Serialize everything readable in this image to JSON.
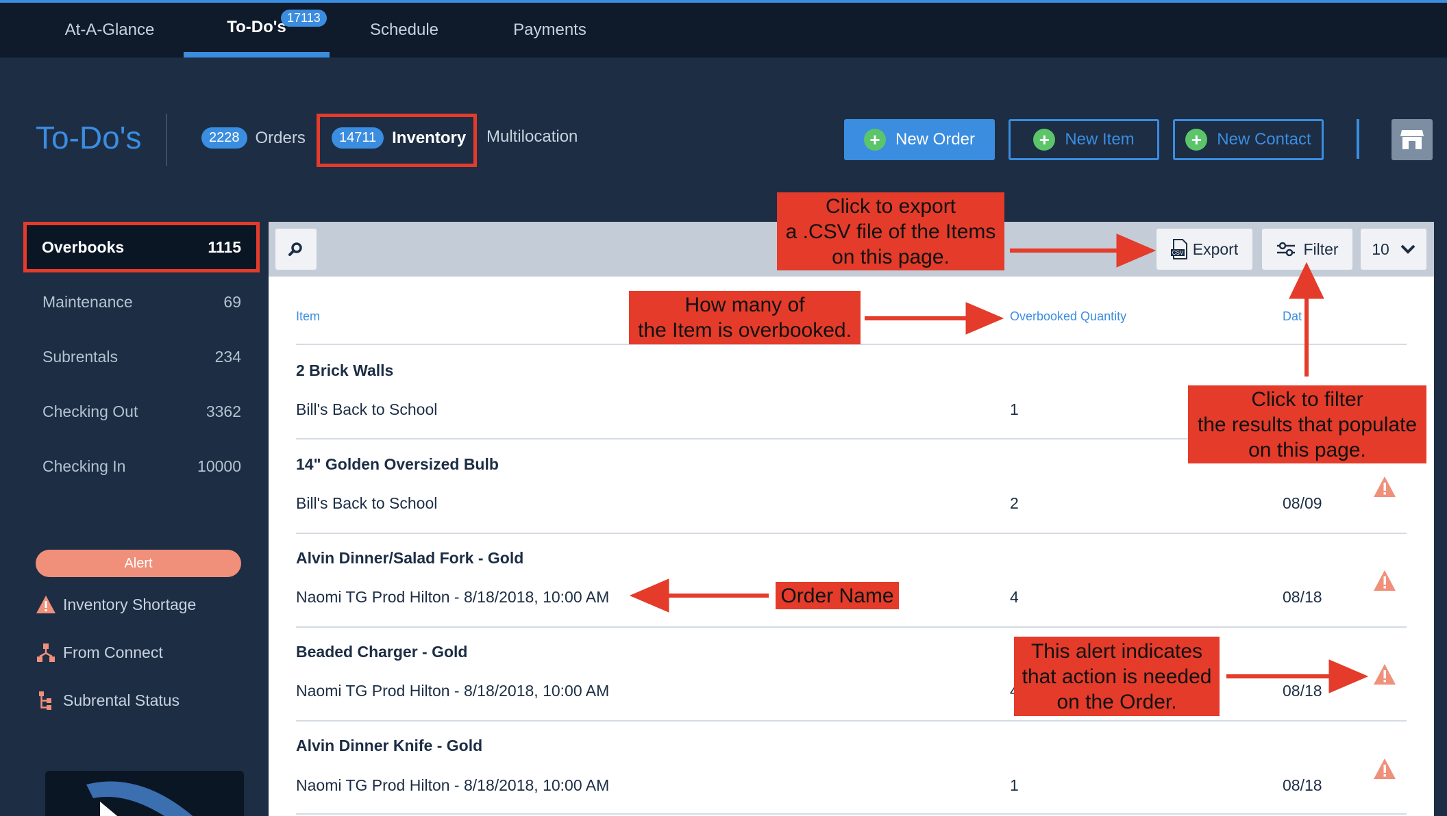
{
  "topnav": {
    "tabs": [
      {
        "label": "At-A-Glance"
      },
      {
        "label": "To-Do's",
        "badge": "17113"
      },
      {
        "label": "Schedule"
      },
      {
        "label": "Payments"
      }
    ]
  },
  "header": {
    "title": "To-Do's",
    "subtabs": [
      {
        "count": "2228",
        "label": "Orders"
      },
      {
        "count": "14711",
        "label": "Inventory"
      },
      {
        "label": "Multilocation"
      }
    ],
    "buttons": {
      "new_order": "New Order",
      "new_item": "New Item",
      "new_contact": "New Contact"
    }
  },
  "sidebar": {
    "items": [
      {
        "label": "Overbooks",
        "count": "1115"
      },
      {
        "label": "Maintenance",
        "count": "69"
      },
      {
        "label": "Subrentals",
        "count": "234"
      },
      {
        "label": "Checking Out",
        "count": "3362"
      },
      {
        "label": "Checking In",
        "count": "10000"
      }
    ],
    "alert_label": "Alert",
    "links": [
      {
        "label": "Inventory Shortage",
        "icon": "warning-icon"
      },
      {
        "label": "From Connect",
        "icon": "network-icon"
      },
      {
        "label": "Subrental Status",
        "icon": "subrental-icon"
      }
    ]
  },
  "toolbar": {
    "export_label": "Export",
    "filter_label": "Filter",
    "per_page": "10"
  },
  "table": {
    "columns": {
      "item": "Item",
      "qty": "Overbooked Quantity",
      "date": "Dat"
    },
    "rows": [
      {
        "item": "2 Brick Walls",
        "order": "Bill's Back to School",
        "qty": "1",
        "date": ""
      },
      {
        "item": "14\" Golden Oversized Bulb",
        "order": "Bill's Back to School",
        "qty": "2",
        "date": "08/09"
      },
      {
        "item": "Alvin Dinner/Salad Fork - Gold",
        "order": "Naomi TG Prod Hilton - 8/18/2018, 10:00 AM",
        "qty": "4",
        "date": "08/18"
      },
      {
        "item": "Beaded Charger - Gold",
        "order": "Naomi TG Prod Hilton - 8/18/2018, 10:00 AM",
        "qty": "4",
        "date": "08/18"
      },
      {
        "item": "Alvin Dinner Knife - Gold",
        "order": "Naomi TG Prod Hilton - 8/18/2018, 10:00 AM",
        "qty": "1",
        "date": "08/18"
      }
    ]
  },
  "annotations": {
    "export": "Click to export\na .CSV file of the Items\non this page.",
    "overbooked": "How many of\nthe Item is overbooked.",
    "filter": "Click to filter\nthe results that populate\non this page.",
    "order_name": "Order Name",
    "alert": "This alert indicates\nthat action is needed\non the Order."
  },
  "colors": {
    "accent": "#3b8de0",
    "annotation_red": "#e43b2a",
    "alert_orange": "#f0907a",
    "success_green": "#5cc56a"
  }
}
